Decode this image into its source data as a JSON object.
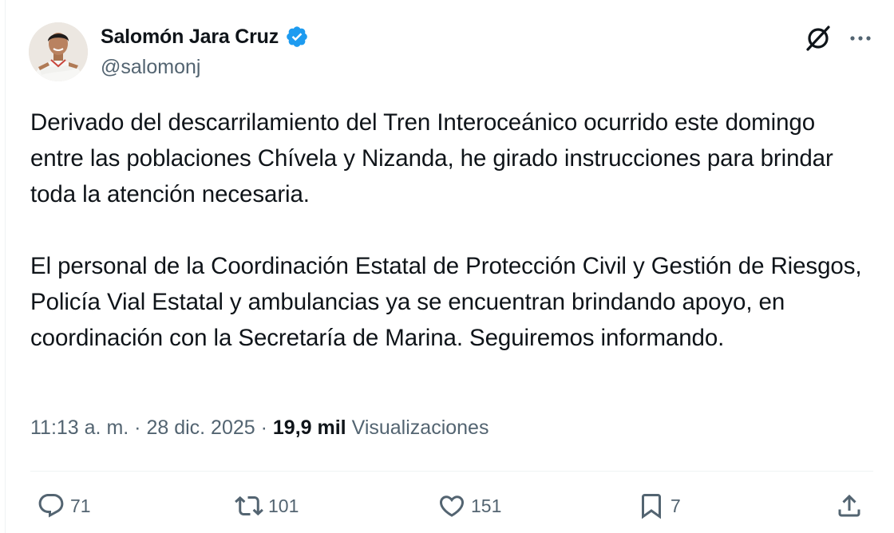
{
  "author": {
    "display_name": "Salomón Jara Cruz",
    "handle": "@salomonj",
    "verified": true
  },
  "tweet": {
    "paragraphs": [
      "Derivado del descarrilamiento del Tren Interoceánico ocurrido este domingo entre las poblaciones Chívela y Nizanda, he girado instrucciones para brindar toda la atención necesaria.",
      "El personal de la Coordinación Estatal de Protección Civil y Gestión de Riesgos, Policía Vial Estatal y ambulancias ya se encuentran brindando apoyo, en coordinación con la Secretaría de Marina. Seguiremos informando."
    ],
    "time": "11:13 a. m.",
    "date": "28 dic. 2025",
    "separator": "·",
    "views_count": "19,9 mil",
    "views_label": "Visualizaciones"
  },
  "actions": {
    "replies": "71",
    "reposts": "101",
    "likes": "151",
    "bookmarks": "7"
  },
  "icons": {
    "verified": "verified-badge-icon",
    "grok": "grok-icon",
    "more": "more-dots-icon",
    "reply": "reply-icon",
    "repost": "repost-icon",
    "like": "heart-icon",
    "bookmark": "bookmark-icon",
    "share": "share-icon"
  },
  "colors": {
    "text": "#0f1419",
    "secondary": "#536471",
    "verified": "#1d9bf0",
    "divider": "#eff3f4"
  }
}
